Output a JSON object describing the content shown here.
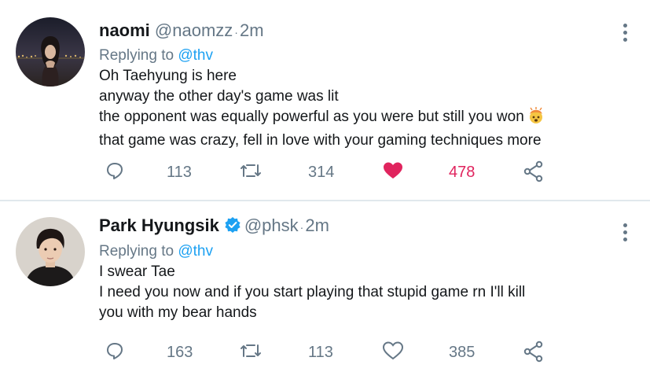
{
  "tweets": [
    {
      "name": "naomi",
      "handle": "@naomzz",
      "separator": "·",
      "time": "2m",
      "replying_prefix": "Replying to",
      "replying_to": "@thv",
      "lines": [
        "Oh Taehyung is here",
        "anyway the other day's game was lit",
        "the opponent was equally powerful as you were but still you won",
        "that game was crazy, fell in love with your gaming techniques more"
      ],
      "replies": "113",
      "retweets": "314",
      "likes": "478",
      "liked": true
    },
    {
      "name": "Park Hyungsik",
      "verified": true,
      "handle": "@phsk",
      "separator": "·",
      "time": "2m",
      "replying_prefix": "Replying to",
      "replying_to": "@thv",
      "lines": [
        "I swear Tae",
        "I need you now and if you start playing that stupid game rn I'll kill",
        "you with my bear hands"
      ],
      "replies": "163",
      "retweets": "113",
      "likes": "385",
      "liked": false
    }
  ],
  "icons": {
    "reply": "reply-icon",
    "retweet": "retweet-icon",
    "like": "heart-icon",
    "share": "share-icon",
    "more": "more-vertical-icon",
    "verified": "verified-badge-icon",
    "emoji": "exploding-head-emoji"
  },
  "colors": {
    "accent": "#1da1f2",
    "liked": "#e0245e",
    "muted": "#657786",
    "text": "#14171a"
  }
}
